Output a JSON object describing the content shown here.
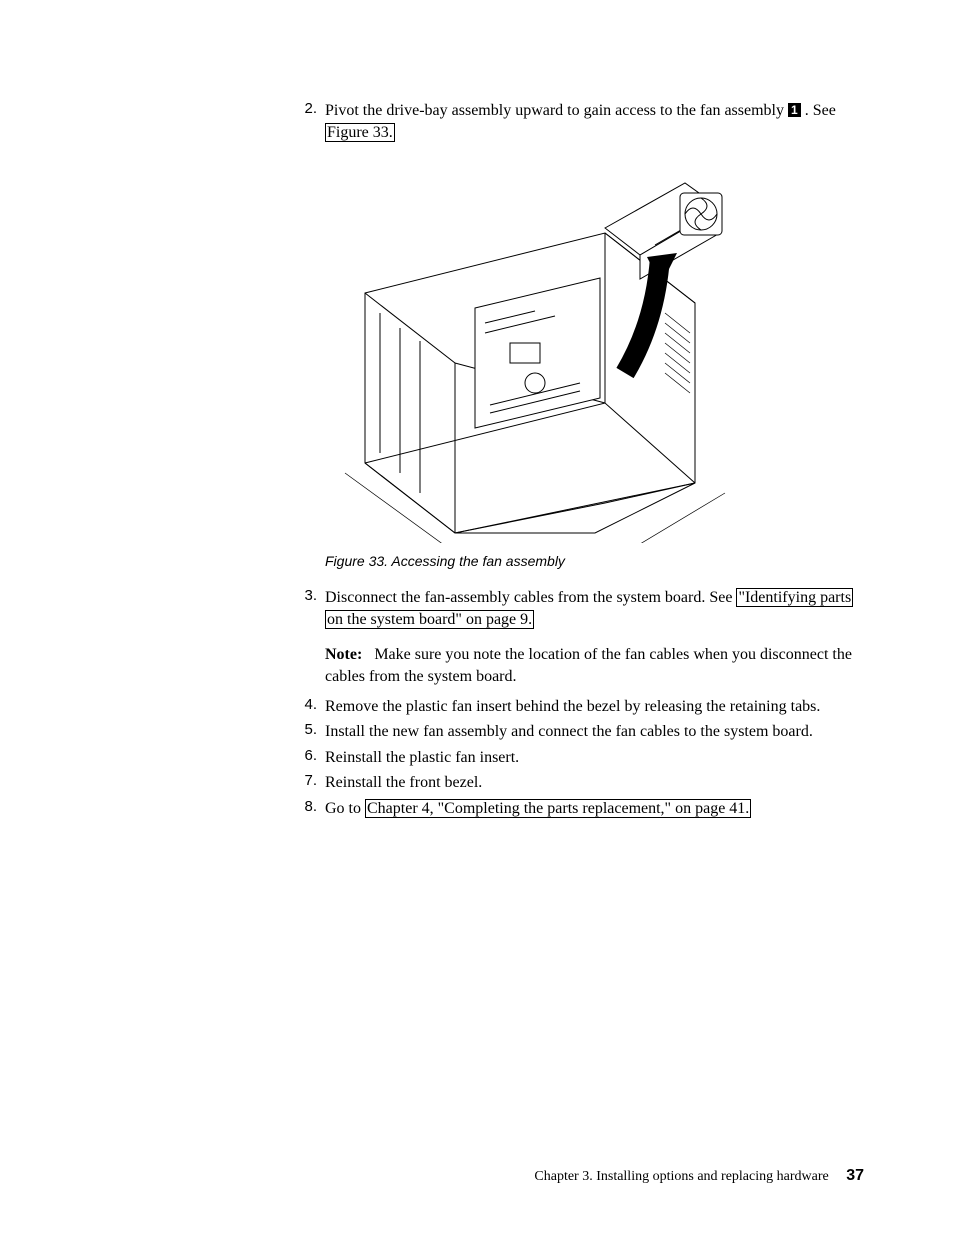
{
  "steps_top": {
    "num": "2.",
    "text_pre": "Pivot the drive-bay assembly upward to gain access to the fan assembly ",
    "callout": "1",
    "text_post": " . See ",
    "xref": "Figure 33."
  },
  "figure": {
    "caption": "Figure 33. Accessing the fan assembly"
  },
  "step3": {
    "num": "3.",
    "text_pre": "Disconnect the fan-assembly cables from the system board. See ",
    "xref": "\"Identifying parts on the system board\" on page 9."
  },
  "note": {
    "label": "Note:",
    "text": "Make sure you note the location of the fan cables when you disconnect the cables from the system board."
  },
  "step4": {
    "num": "4.",
    "text": "Remove the plastic fan insert behind the bezel by releasing the retaining tabs."
  },
  "step5": {
    "num": "5.",
    "text": "Install the new fan assembly and connect the fan cables to the system board."
  },
  "step6": {
    "num": "6.",
    "text": "Reinstall the plastic fan insert."
  },
  "step7": {
    "num": "7.",
    "text": "Reinstall the front bezel."
  },
  "step8": {
    "num": "8.",
    "text_pre": "Go to ",
    "xref": "Chapter 4, \"Completing the parts replacement,\" on page 41."
  },
  "footer": {
    "chapter": "Chapter 3. Installing options and replacing hardware",
    "page": "37"
  }
}
